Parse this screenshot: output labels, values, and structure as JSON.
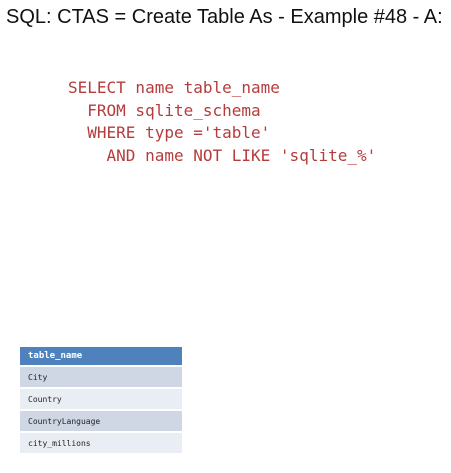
{
  "title": "SQL: CTAS = Create Table As - Example #48 - A:",
  "query": {
    "lines": [
      "SELECT name table_name",
      "  FROM sqlite_schema",
      "  WHERE type ='table'",
      "    AND name NOT LIKE 'sqlite_%'"
    ]
  },
  "result": {
    "header": "table_name",
    "rows": [
      "City",
      "Country",
      "CountryLanguage",
      "city_millions"
    ]
  },
  "colors": {
    "sql_text": "#b43c3c",
    "header_bg": "#4f81bd",
    "row_odd": "#cfd7e5",
    "row_even": "#e9edf4"
  }
}
